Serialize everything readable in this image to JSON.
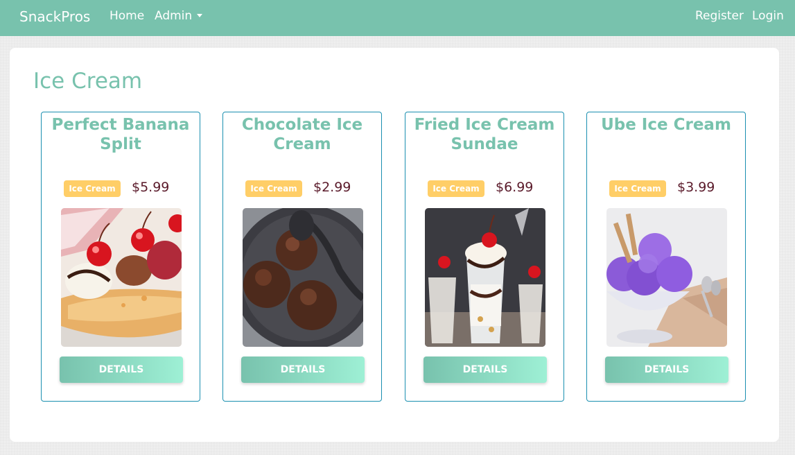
{
  "navbar": {
    "brand": "SnackPros",
    "home": "Home",
    "admin": "Admin",
    "register": "Register",
    "login": "Login"
  },
  "page": {
    "title": "Ice Cream"
  },
  "products": [
    {
      "name": "Perfect Banana Split",
      "category": "Ice Cream",
      "price": "$5.99",
      "button": "DETAILS"
    },
    {
      "name": "Chocolate Ice Cream",
      "category": "Ice Cream",
      "price": "$2.99",
      "button": "DETAILS"
    },
    {
      "name": "Fried Ice Cream Sundae",
      "category": "Ice Cream",
      "price": "$6.99",
      "button": "DETAILS"
    },
    {
      "name": "Ube Ice Cream",
      "category": "Ice Cream",
      "price": "$3.99",
      "button": "DETAILS"
    }
  ],
  "colors": {
    "primary": "#78c2ad",
    "badge": "#ffce67",
    "price": "#5a1a2a",
    "card_border": "#1a8fb0"
  }
}
